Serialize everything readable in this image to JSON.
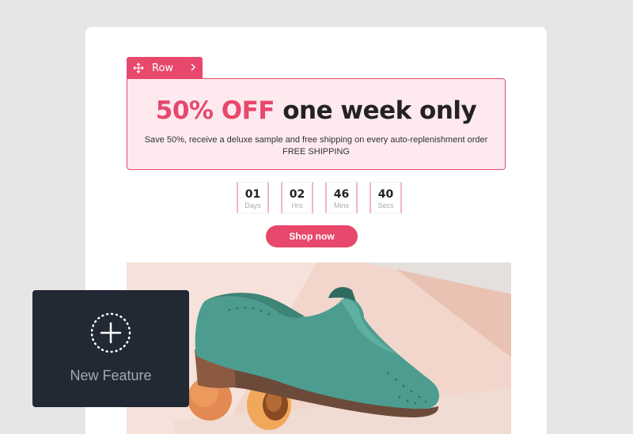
{
  "row_toolbar": {
    "label": "Row",
    "icons": [
      "move-icon",
      "chevron-right-icon"
    ]
  },
  "banner": {
    "headline_accent": "50% OFF",
    "headline_rest": "one week only",
    "subtext_line1": "Save 50%, receive a deluxe sample and free shipping on every auto-replenishment order",
    "subtext_line2": "FREE SHIPPING"
  },
  "countdown": [
    {
      "value": "01",
      "unit": "Days"
    },
    {
      "value": "02",
      "unit": "Hrs"
    },
    {
      "value": "46",
      "unit": "Mins"
    },
    {
      "value": "40",
      "unit": "Secs"
    }
  ],
  "cta": {
    "label": "Shop now"
  },
  "product": {
    "image": "teal suede brogue shoe resting on apricot halves"
  },
  "new_feature": {
    "label": "New Feature",
    "icon": "plus-circle-icon"
  },
  "colors": {
    "accent": "#e7486c",
    "banner_bg": "#fde9ee",
    "feature_card_bg": "#232835"
  }
}
